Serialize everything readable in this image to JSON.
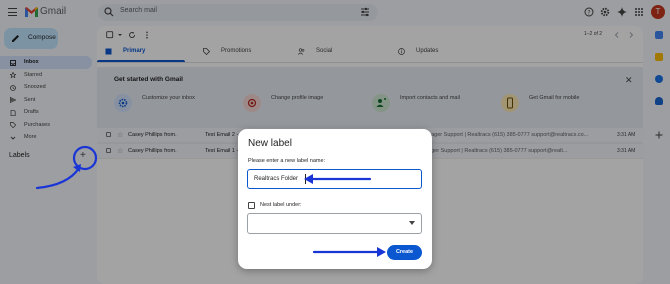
{
  "app": {
    "name": "Gmail",
    "search_placeholder": "Search mail",
    "avatar_letter": "T"
  },
  "compose": {
    "label": "Compose"
  },
  "sidebar": {
    "items": [
      {
        "label": "Inbox",
        "icon": "inbox-icon",
        "active": true
      },
      {
        "label": "Starred",
        "icon": "star-icon"
      },
      {
        "label": "Snoozed",
        "icon": "clock-icon"
      },
      {
        "label": "Sent",
        "icon": "send-icon"
      },
      {
        "label": "Drafts",
        "icon": "draft-icon"
      },
      {
        "label": "Purchases",
        "icon": "tag-icon"
      },
      {
        "label": "More",
        "icon": "chevron-down-icon"
      }
    ],
    "labels_heading": "Labels",
    "add_label": "+"
  },
  "toolbar": {
    "pager": "1–2 of 2"
  },
  "tabs": [
    {
      "label": "Primary",
      "icon": "inbox-icon"
    },
    {
      "label": "Promotions",
      "icon": "tag-icon"
    },
    {
      "label": "Social",
      "icon": "people-icon"
    },
    {
      "label": "Updates",
      "icon": "info-icon"
    }
  ],
  "get_started": {
    "title": "Get started with Gmail",
    "close": "✕",
    "cards": [
      {
        "text": "Customize your inbox",
        "icon": "gear-icon",
        "color": "#d3e3fd"
      },
      {
        "text": "Change profile image",
        "icon": "camera-icon",
        "color": "#f6d6d3"
      },
      {
        "text": "Import contacts and mail",
        "icon": "contacts-icon",
        "color": "#cfe8d2"
      },
      {
        "text": "Get Gmail for mobile",
        "icon": "phone-icon",
        "color": "#fde9b6"
      }
    ]
  },
  "emails": [
    {
      "sender": "Casey Phillips from.",
      "subject": "Test Email 2 -",
      "snippet": "anager Support | Realtracs (615) 385-0777 support@realtracs.co...",
      "time": "3:31 AM"
    },
    {
      "sender": "Casey Phillips from.",
      "subject": "Test Email 1 -",
      "snippet": "nager Support | Realtracs (615) 385-0777 support@realt...",
      "time": "3:31 AM"
    }
  ],
  "dialog": {
    "title": "New label",
    "prompt": "Please enter a new label name:",
    "input_value": "Realtracs Folder",
    "nest_label": "Nest label under:",
    "nest_selected": "",
    "create_label": "Create"
  },
  "colors": {
    "accent": "#0b57d0",
    "annotation": "#1a35d6"
  }
}
